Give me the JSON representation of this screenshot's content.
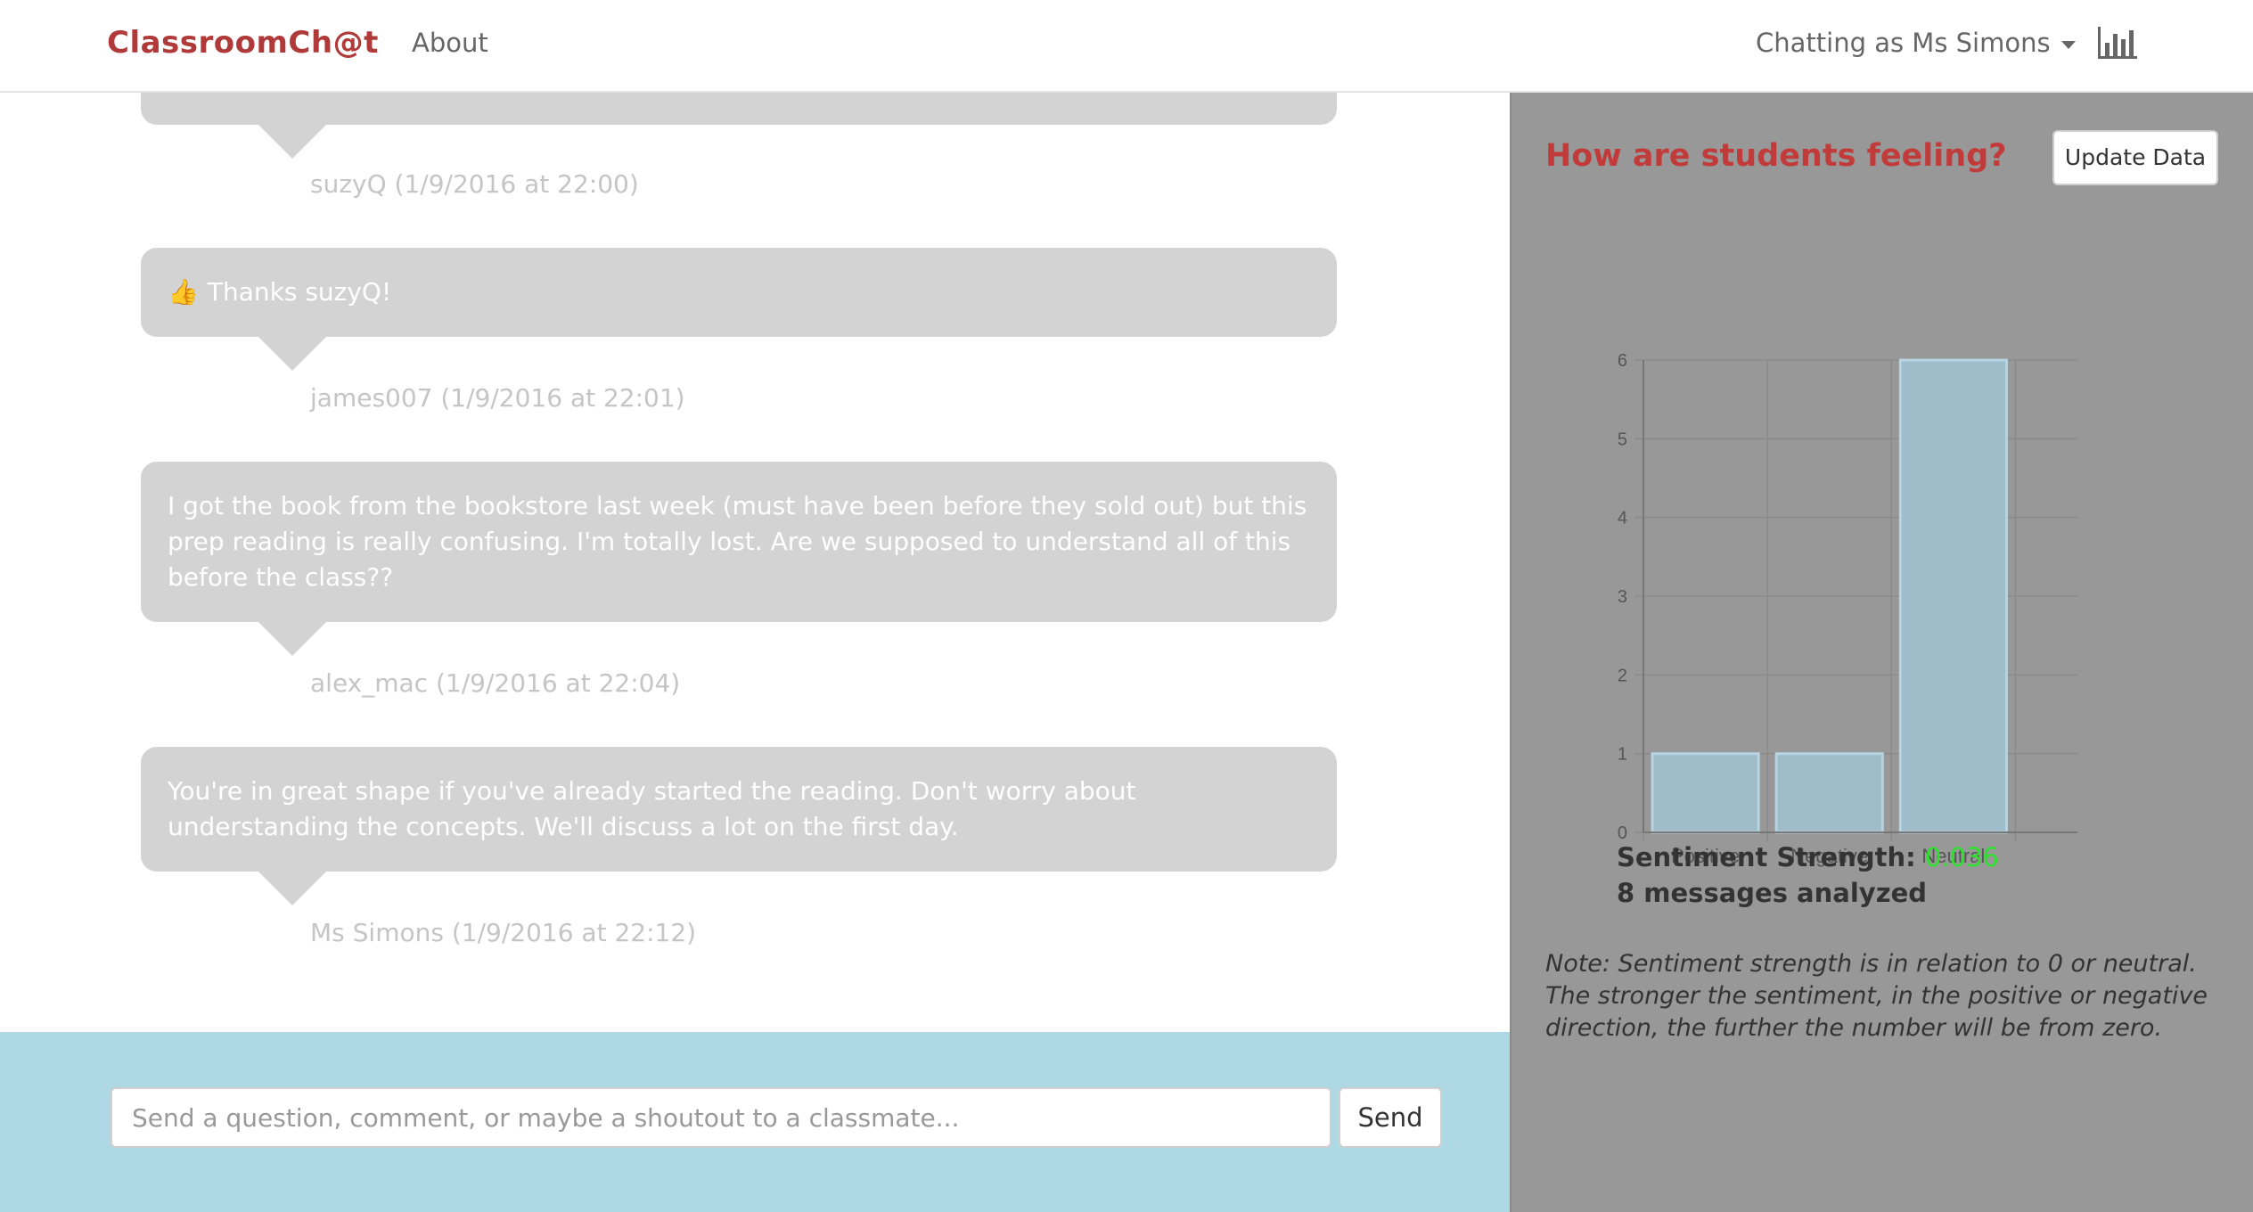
{
  "navbar": {
    "brand": "ClassroomCh@t",
    "about": "About",
    "user_menu": "Chatting as Ms Simons",
    "chart_icon": "bar-chart-icon"
  },
  "messages": [
    {
      "text": "",
      "author_meta": "suzyQ (1/9/2016 at 22:00)"
    },
    {
      "icon": "thumbs-up-icon",
      "text": "Thanks suzyQ!",
      "author_meta": "james007 (1/9/2016 at 22:01)"
    },
    {
      "text": "I got the book from the bookstore last week (must have been before they sold out) but this prep reading is really confusing. I'm totally lost. Are we supposed to understand all of this before the class??",
      "author_meta": "alex_mac (1/9/2016 at 22:04)"
    },
    {
      "text": "You're in great shape if you've already started the reading. Don't worry about understanding the concepts. We'll discuss a lot on the first day.",
      "author_meta": "Ms Simons (1/9/2016 at 22:12)"
    }
  ],
  "composer": {
    "placeholder": "Send a question, comment, or maybe a shoutout to a classmate...",
    "send_label": "Send"
  },
  "panel": {
    "title": "How are students feeling?",
    "update_button": "Update Data",
    "strength_label": "Sentiment Strength:",
    "strength_value": "0.036",
    "analyzed_count": "8",
    "analyzed_label": "messages analyzed",
    "note": "Note: Sentiment strength is in relation to 0 or neutral. The stronger the sentiment, in the positive or negative direction, the further the number will be from zero."
  },
  "colors": {
    "brand": "#b03a3a",
    "panel_title": "#c23b3b",
    "bubble": "#d3d3d3",
    "composer_bg": "#add8e4",
    "panel_bg": "#989898",
    "bar_fill": "#9fbccb",
    "strength_value": "#2ee12e"
  },
  "chart_data": {
    "type": "bar",
    "categories": [
      "Positive",
      "Negative",
      "Neutral"
    ],
    "values": [
      1,
      1,
      6
    ],
    "title": "",
    "xlabel": "",
    "ylabel": "",
    "ylim": [
      0,
      6
    ],
    "yticks": [
      0,
      1,
      2,
      3,
      4,
      5,
      6
    ],
    "grid": true,
    "legend": "none"
  }
}
